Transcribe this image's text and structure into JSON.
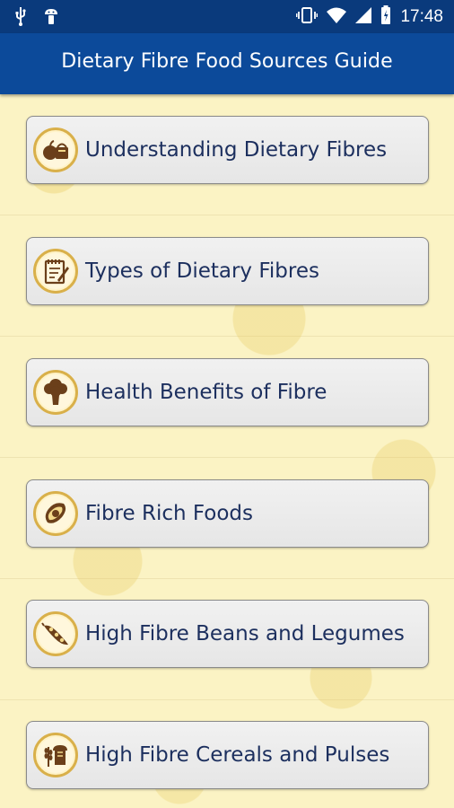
{
  "status_bar": {
    "time": "17:48",
    "icons": [
      "usb-icon",
      "android-icon",
      "vibrate-icon",
      "wifi-icon",
      "signal-icon",
      "battery-icon"
    ]
  },
  "toolbar": {
    "title": "Dietary Fibre Food Sources Guide"
  },
  "menu": {
    "items": [
      {
        "label": "Understanding Dietary Fibres",
        "icon": "food-basket-icon"
      },
      {
        "label": "Types of Dietary Fibres",
        "icon": "notepad-icon"
      },
      {
        "label": "Health Benefits of Fibre",
        "icon": "broccoli-icon"
      },
      {
        "label": "Fibre Rich Foods",
        "icon": "avocado-icon"
      },
      {
        "label": "High Fibre Beans and Legumes",
        "icon": "bean-pod-icon"
      },
      {
        "label": "High Fibre Cereals and Pulses",
        "icon": "bread-wheat-icon"
      }
    ]
  },
  "colors": {
    "status_bar": "#0a3a7c",
    "toolbar": "#0c4a9a",
    "background": "#fbf3c4",
    "button_text": "#1c2f5e",
    "icon_ring": "#d9b04a",
    "icon_brown": "#6b3f1a"
  }
}
